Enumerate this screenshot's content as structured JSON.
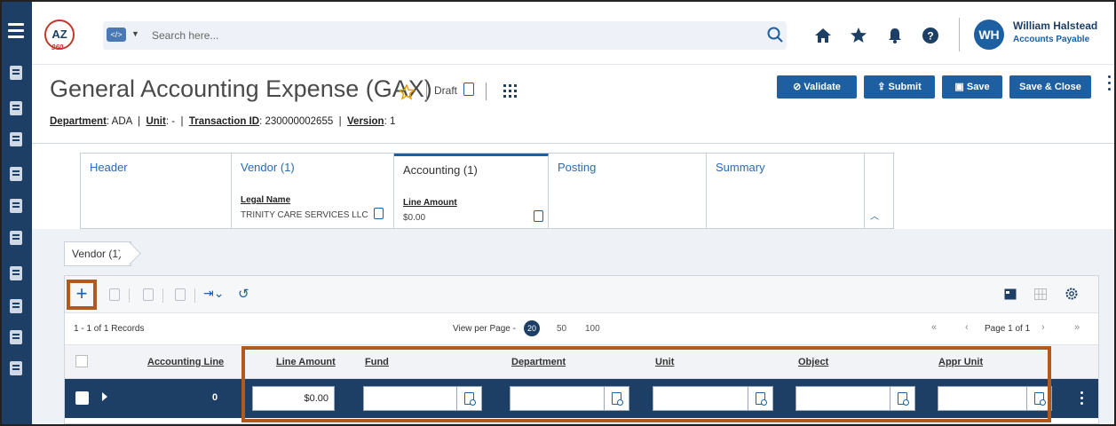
{
  "colors": {
    "brand": "#1d3f66",
    "accent": "#1d5fa0",
    "highlight": "#b05a1e"
  },
  "app": {
    "logo_text": "AZ",
    "logo_sub": "360",
    "search_scope": "</>",
    "search_placeholder": "Search here..."
  },
  "user": {
    "initials": "WH",
    "name": "William Halstead",
    "role": "Accounts Payable"
  },
  "page": {
    "title": "General Accounting Expense (GAX)",
    "status": "Draft",
    "meta": {
      "department_label": "Department",
      "department_value": "ADA",
      "unit_label": "Unit",
      "unit_value": "-",
      "txn_label": "Transaction ID",
      "txn_value": "230000002655",
      "version_label": "Version",
      "version_value": "1"
    }
  },
  "actions": {
    "validate": "Validate",
    "submit": "Submit",
    "save": "Save",
    "save_close": "Save & Close"
  },
  "tabs": [
    {
      "label": "Header"
    },
    {
      "label": "Vendor (1)",
      "sub_label": "Legal Name",
      "sub_value": "TRINITY CARE SERVICES LLC"
    },
    {
      "label": "Accounting (1)",
      "sub_label": "Line Amount",
      "sub_value": "$0.00"
    },
    {
      "label": "Posting"
    },
    {
      "label": "Summary"
    }
  ],
  "breadcrumb": "Vendor (1)",
  "grid": {
    "add_symbol": "+",
    "records_text": "1 - 1 of 1 Records",
    "view_per_page_label": "View per Page -",
    "page_sizes": [
      "20",
      "50",
      "100"
    ],
    "page_label": "Page 1 of 1",
    "columns": [
      "Accounting Line",
      "Line Amount",
      "Fund",
      "Department",
      "Unit",
      "Object",
      "Appr Unit"
    ],
    "row": {
      "accounting_line": "0",
      "line_amount": "$0.00",
      "fund": "",
      "department": "",
      "unit": "",
      "object": "",
      "appr_unit": ""
    }
  }
}
